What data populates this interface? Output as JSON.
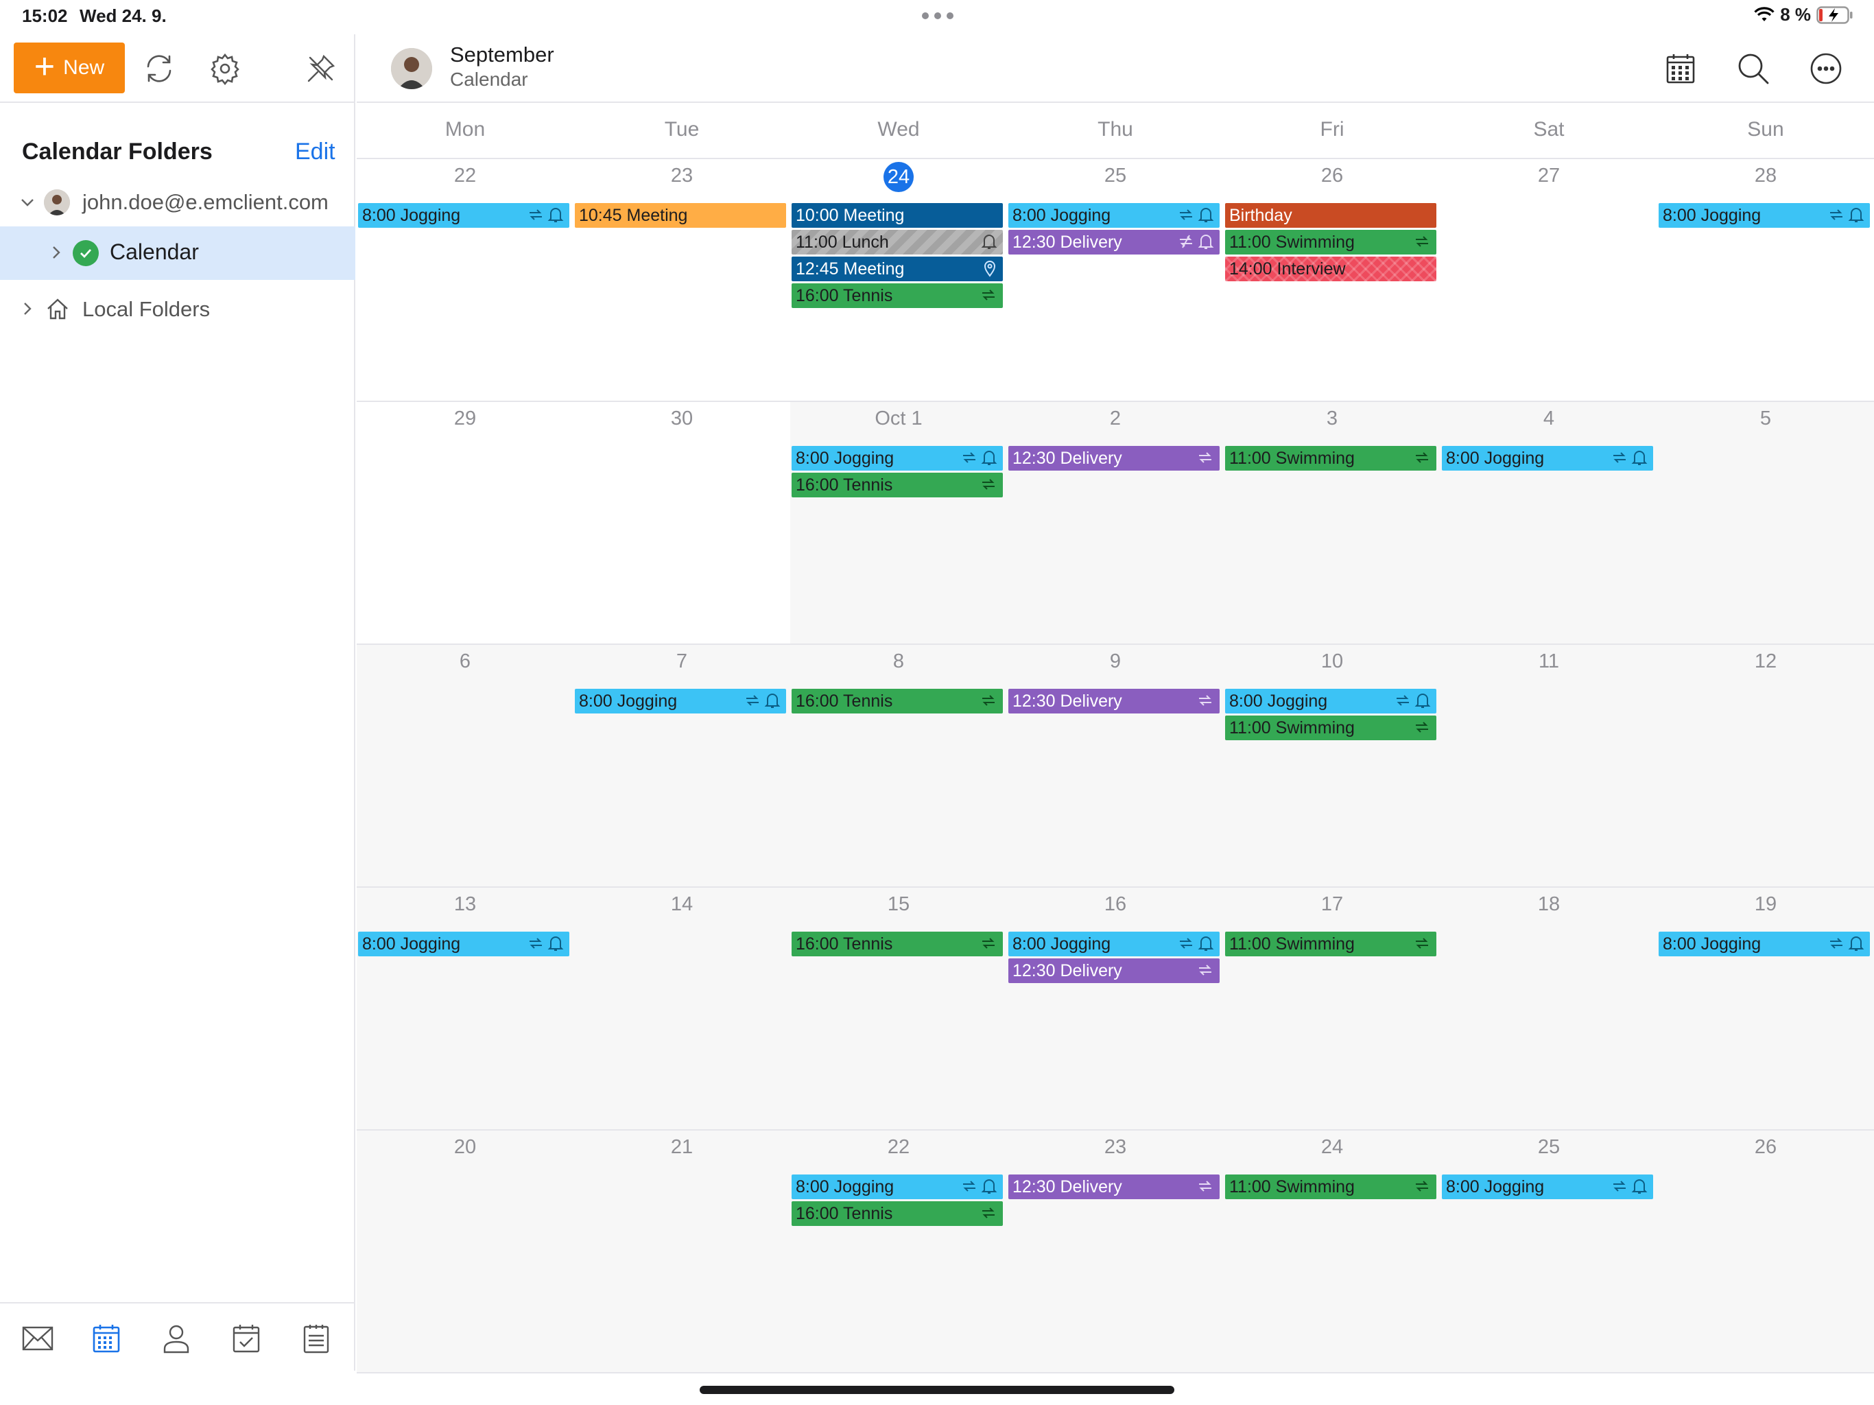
{
  "status_bar": {
    "time": "15:02",
    "date": "Wed 24. 9.",
    "battery": "8 %"
  },
  "sidebar": {
    "new_label": "New",
    "folders_title": "Calendar Folders",
    "edit_label": "Edit",
    "account": "john.doe@e.emclient.com",
    "calendar_label": "Calendar",
    "local_folders_label": "Local Folders"
  },
  "header": {
    "title": "September",
    "subtitle": "Calendar"
  },
  "days_of_week": [
    "Mon",
    "Tue",
    "Wed",
    "Thu",
    "Fri",
    "Sat",
    "Sun"
  ],
  "weeks": [
    {
      "days": [
        {
          "label": "22",
          "past": false,
          "today": false,
          "events": [
            {
              "text": "8:00 Jogging",
              "color": "cyan",
              "icons": [
                "repeat",
                "bell"
              ]
            }
          ]
        },
        {
          "label": "23",
          "past": false,
          "today": false,
          "events": [
            {
              "text": "10:45 Meeting",
              "color": "orange",
              "icons": []
            }
          ]
        },
        {
          "label": "24",
          "past": false,
          "today": true,
          "events": [
            {
              "text": "10:00 Meeting",
              "color": "navy",
              "icons": []
            },
            {
              "text": "11:00 Lunch",
              "color": "gray",
              "icons": [
                "bell"
              ]
            },
            {
              "text": "12:45 Meeting",
              "color": "navy",
              "icons": [
                "pin"
              ]
            },
            {
              "text": "16:00 Tennis",
              "color": "green",
              "icons": [
                "repeat"
              ]
            }
          ]
        },
        {
          "label": "25",
          "past": false,
          "today": false,
          "events": [
            {
              "text": "8:00 Jogging",
              "color": "cyan",
              "icons": [
                "repeat",
                "bell"
              ]
            },
            {
              "text": "12:30 Delivery",
              "color": "purple",
              "icons": [
                "repeat-off",
                "bell"
              ]
            }
          ]
        },
        {
          "label": "26",
          "past": false,
          "today": false,
          "events": [
            {
              "text": "Birthday",
              "color": "rust",
              "icons": []
            },
            {
              "text": "11:00 Swimming",
              "color": "green",
              "icons": [
                "repeat"
              ]
            },
            {
              "text": "14:00 Interview",
              "color": "red",
              "icons": []
            }
          ]
        },
        {
          "label": "27",
          "past": false,
          "today": false,
          "events": []
        },
        {
          "label": "28",
          "past": false,
          "today": false,
          "events": [
            {
              "text": "8:00 Jogging",
              "color": "cyan",
              "icons": [
                "repeat",
                "bell"
              ]
            }
          ]
        }
      ]
    },
    {
      "days": [
        {
          "label": "29",
          "past": false,
          "today": false,
          "events": []
        },
        {
          "label": "30",
          "past": false,
          "today": false,
          "events": []
        },
        {
          "label": "Oct  1",
          "past": true,
          "today": false,
          "events": [
            {
              "text": "8:00 Jogging",
              "color": "cyan",
              "icons": [
                "repeat",
                "bell"
              ]
            },
            {
              "text": "16:00 Tennis",
              "color": "green",
              "icons": [
                "repeat"
              ]
            }
          ]
        },
        {
          "label": "2",
          "past": true,
          "today": false,
          "events": [
            {
              "text": "12:30 Delivery",
              "color": "purple",
              "icons": [
                "repeat"
              ]
            }
          ]
        },
        {
          "label": "3",
          "past": true,
          "today": false,
          "events": [
            {
              "text": "11:00 Swimming",
              "color": "green",
              "icons": [
                "repeat"
              ]
            }
          ]
        },
        {
          "label": "4",
          "past": true,
          "today": false,
          "events": [
            {
              "text": "8:00 Jogging",
              "color": "cyan",
              "icons": [
                "repeat",
                "bell"
              ]
            }
          ]
        },
        {
          "label": "5",
          "past": true,
          "today": false,
          "events": []
        }
      ]
    },
    {
      "days": [
        {
          "label": "6",
          "past": true,
          "today": false,
          "events": []
        },
        {
          "label": "7",
          "past": true,
          "today": false,
          "events": [
            {
              "text": "8:00 Jogging",
              "color": "cyan",
              "icons": [
                "repeat",
                "bell"
              ]
            }
          ]
        },
        {
          "label": "8",
          "past": true,
          "today": false,
          "events": [
            {
              "text": "16:00 Tennis",
              "color": "green",
              "icons": [
                "repeat"
              ]
            }
          ]
        },
        {
          "label": "9",
          "past": true,
          "today": false,
          "events": [
            {
              "text": "12:30 Delivery",
              "color": "purple",
              "icons": [
                "repeat"
              ]
            }
          ]
        },
        {
          "label": "10",
          "past": true,
          "today": false,
          "events": [
            {
              "text": "8:00 Jogging",
              "color": "cyan",
              "icons": [
                "repeat",
                "bell"
              ]
            },
            {
              "text": "11:00 Swimming",
              "color": "green",
              "icons": [
                "repeat"
              ]
            }
          ]
        },
        {
          "label": "11",
          "past": true,
          "today": false,
          "events": []
        },
        {
          "label": "12",
          "past": true,
          "today": false,
          "events": []
        }
      ]
    },
    {
      "days": [
        {
          "label": "13",
          "past": true,
          "today": false,
          "events": [
            {
              "text": "8:00 Jogging",
              "color": "cyan",
              "icons": [
                "repeat",
                "bell"
              ]
            }
          ]
        },
        {
          "label": "14",
          "past": true,
          "today": false,
          "events": []
        },
        {
          "label": "15",
          "past": true,
          "today": false,
          "events": [
            {
              "text": "16:00 Tennis",
              "color": "green",
              "icons": [
                "repeat"
              ]
            }
          ]
        },
        {
          "label": "16",
          "past": true,
          "today": false,
          "events": [
            {
              "text": "8:00 Jogging",
              "color": "cyan",
              "icons": [
                "repeat",
                "bell"
              ]
            },
            {
              "text": "12:30 Delivery",
              "color": "purple",
              "icons": [
                "repeat"
              ]
            }
          ]
        },
        {
          "label": "17",
          "past": true,
          "today": false,
          "events": [
            {
              "text": "11:00 Swimming",
              "color": "green",
              "icons": [
                "repeat"
              ]
            }
          ]
        },
        {
          "label": "18",
          "past": true,
          "today": false,
          "events": []
        },
        {
          "label": "19",
          "past": true,
          "today": false,
          "events": [
            {
              "text": "8:00 Jogging",
              "color": "cyan",
              "icons": [
                "repeat",
                "bell"
              ]
            }
          ]
        }
      ]
    },
    {
      "days": [
        {
          "label": "20",
          "past": true,
          "today": false,
          "events": []
        },
        {
          "label": "21",
          "past": true,
          "today": false,
          "events": []
        },
        {
          "label": "22",
          "past": true,
          "today": false,
          "events": [
            {
              "text": "8:00 Jogging",
              "color": "cyan",
              "icons": [
                "repeat",
                "bell"
              ]
            },
            {
              "text": "16:00 Tennis",
              "color": "green",
              "icons": [
                "repeat"
              ]
            }
          ]
        },
        {
          "label": "23",
          "past": true,
          "today": false,
          "events": [
            {
              "text": "12:30 Delivery",
              "color": "purple",
              "icons": [
                "repeat"
              ]
            }
          ]
        },
        {
          "label": "24",
          "past": true,
          "today": false,
          "events": [
            {
              "text": "11:00 Swimming",
              "color": "green",
              "icons": [
                "repeat"
              ]
            }
          ]
        },
        {
          "label": "25",
          "past": true,
          "today": false,
          "events": [
            {
              "text": "8:00 Jogging",
              "color": "cyan",
              "icons": [
                "repeat",
                "bell"
              ]
            }
          ]
        },
        {
          "label": "26",
          "past": true,
          "today": false,
          "events": []
        }
      ]
    }
  ],
  "colors": {
    "accent": "#1a73e8",
    "new_button": "#f7870f",
    "cyan": "#3cc3f5",
    "orange": "#ffad45",
    "navy": "#075d99",
    "gray": "#a3a3a3",
    "green": "#34a853",
    "purple": "#8a5ebf",
    "rust": "#c94b23",
    "red": "#ee4b5d"
  },
  "bottom_tabs": [
    "mail-icon",
    "calendar-icon",
    "contacts-icon",
    "tasks-icon",
    "notes-icon"
  ]
}
